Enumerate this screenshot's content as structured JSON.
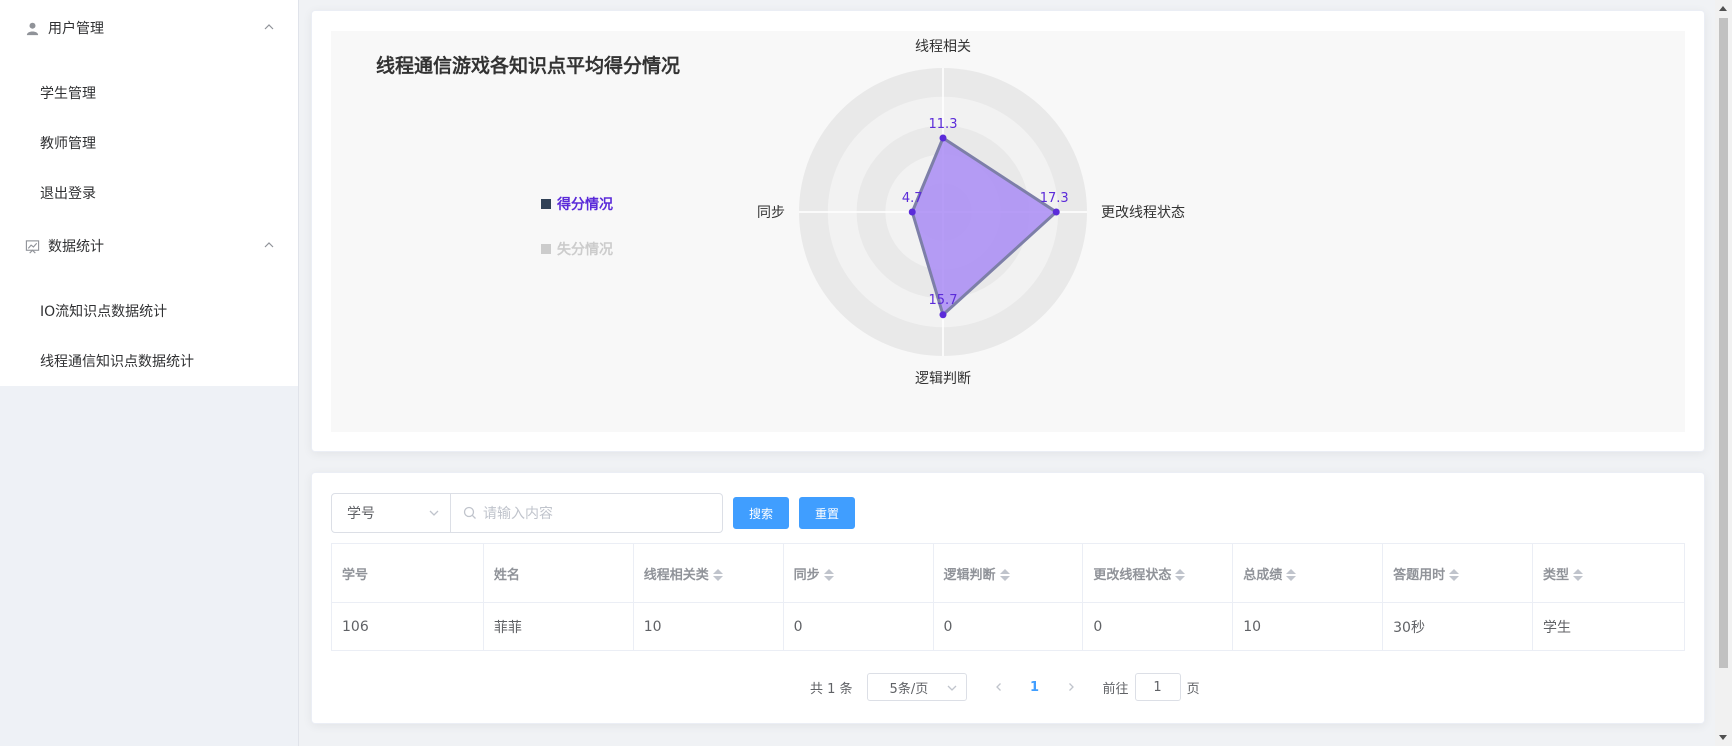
{
  "sidebar": {
    "groups": [
      {
        "label": "用户管理",
        "icon": "user-icon",
        "items": [
          "学生管理",
          "教师管理",
          "退出登录"
        ]
      },
      {
        "label": "数据统计",
        "icon": "chart-icon",
        "items": [
          "IO流知识点数据统计",
          "线程通信知识点数据统计"
        ]
      }
    ]
  },
  "chart_data": {
    "type": "radar",
    "title": "线程通信游戏各知识点平均得分情况",
    "indicators": [
      "线程相关",
      "更改线程状态",
      "逻辑判断",
      "同步"
    ],
    "series": [
      {
        "name": "得分情况",
        "values": [
          11.3,
          17.3,
          15.7,
          4.7
        ],
        "color": "#5b2bd9",
        "fill": "#a98cf5"
      },
      {
        "name": "失分情况",
        "values": [],
        "color": "#cccccc"
      }
    ],
    "legend_active": "#5b2bd9",
    "legend_inactive": "#cccccc"
  },
  "filter": {
    "select_value": "学号",
    "search_placeholder": "请输入内容",
    "search_button": "搜索",
    "reset_button": "重置"
  },
  "table": {
    "columns": [
      "学号",
      "姓名",
      "线程相关类",
      "同步",
      "逻辑判断",
      "更改线程状态",
      "总成绩",
      "答题用时",
      "类型"
    ],
    "sortable": [
      false,
      false,
      true,
      true,
      true,
      true,
      true,
      true,
      true
    ],
    "rows": [
      [
        "106",
        "菲菲",
        "10",
        "0",
        "0",
        "0",
        "10",
        "30秒",
        "学生"
      ]
    ]
  },
  "pagination": {
    "total_text": "共 1 条",
    "page_size": "5条/页",
    "current_page": "1",
    "goto_prefix": "前往",
    "goto_value": "1",
    "goto_suffix": "页"
  },
  "colors": {
    "accent": "#409eff"
  }
}
